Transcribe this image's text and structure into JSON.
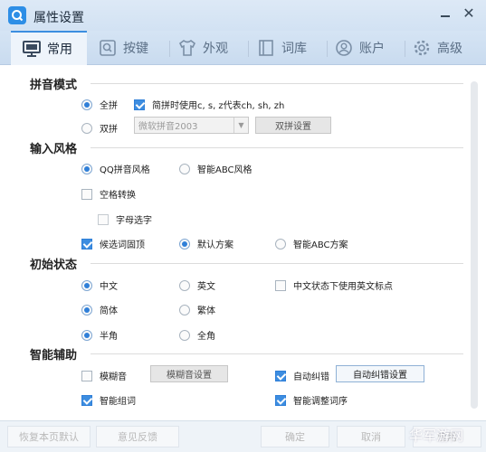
{
  "window": {
    "title": "属性设置"
  },
  "tabs": [
    {
      "label": "常用",
      "icon": "monitor-icon"
    },
    {
      "label": "按键",
      "icon": "key-icon"
    },
    {
      "label": "外观",
      "icon": "shirt-icon"
    },
    {
      "label": "词库",
      "icon": "book-icon"
    },
    {
      "label": "账户",
      "icon": "user-icon"
    },
    {
      "label": "高级",
      "icon": "gear-icon"
    }
  ],
  "sections": {
    "pinyin_mode": {
      "title": "拼音模式",
      "full_pinyin": "全拼",
      "simplified_label": "简拼时使用c, s, z代表ch, sh, zh",
      "double_pinyin": "双拼",
      "double_scheme_value": "微软拼音2003",
      "double_settings_button": "双拼设置"
    },
    "input_style": {
      "title": "输入风格",
      "qq_style": "QQ拼音风格",
      "abc_style": "智能ABC风格",
      "space_convert": "空格转换",
      "letter_select": "字母选字",
      "candidate_top": "候选词固顶",
      "default_scheme": "默认方案",
      "abc_scheme": "智能ABC方案"
    },
    "initial_state": {
      "title": "初始状态",
      "chinese": "中文",
      "english": "英文",
      "chinese_english_punct": "中文状态下使用英文标点",
      "simplified": "简体",
      "traditional": "繁体",
      "half_width": "半角",
      "full_width": "全角"
    },
    "smart_assist": {
      "title": "智能辅助",
      "fuzzy": "模糊音",
      "fuzzy_settings_button": "模糊音设置",
      "auto_correct": "自动纠错",
      "auto_correct_settings_button": "自动纠错设置",
      "smart_words": "智能组词",
      "smart_order": "智能调整词序"
    }
  },
  "footer": {
    "restore_default": "恢复本页默认",
    "feedback": "意见反馈",
    "ok": "确定",
    "cancel": "取消",
    "apply": "应用"
  },
  "watermark": "华军游网",
  "colors": {
    "accent": "#2f7fd8",
    "titlebar": "#d2e2f3",
    "tabbar": "#c9dbef"
  }
}
